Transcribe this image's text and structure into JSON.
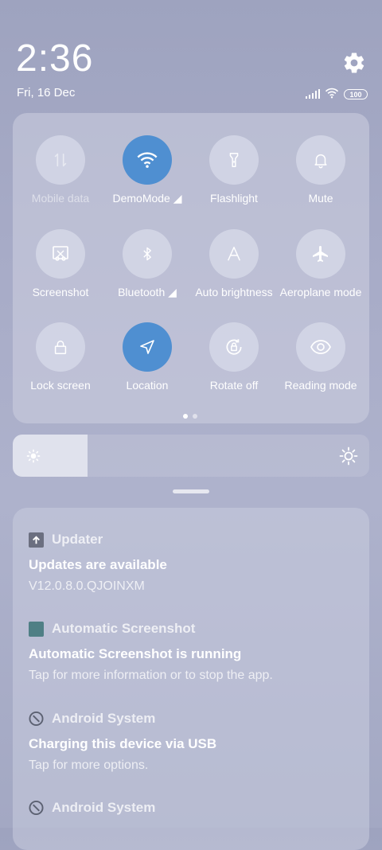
{
  "status": {
    "time": "2:36",
    "date": "Fri, 16 Dec",
    "battery": "100"
  },
  "quick_settings": {
    "tiles": [
      {
        "label": "Mobile data",
        "icon": "mobile-data-icon",
        "state": "disabled"
      },
      {
        "label": "DemoMode",
        "icon": "wifi-icon",
        "state": "on"
      },
      {
        "label": "Flashlight",
        "icon": "flashlight-icon",
        "state": "off"
      },
      {
        "label": "Mute",
        "icon": "bell-icon",
        "state": "off"
      },
      {
        "label": "Screenshot",
        "icon": "screenshot-icon",
        "state": "off"
      },
      {
        "label": "Bluetooth",
        "icon": "bluetooth-icon",
        "state": "off"
      },
      {
        "label": "Auto brightness",
        "icon": "auto-brightness-icon",
        "state": "off"
      },
      {
        "label": "Aeroplane mode",
        "icon": "airplane-icon",
        "state": "off"
      },
      {
        "label": "Lock screen",
        "icon": "lock-icon",
        "state": "off"
      },
      {
        "label": "Location",
        "icon": "location-icon",
        "state": "on"
      },
      {
        "label": "Rotate off",
        "icon": "rotate-lock-icon",
        "state": "off"
      },
      {
        "label": "Reading mode",
        "icon": "eye-icon",
        "state": "off"
      }
    ],
    "page_count": 2,
    "current_page": 1
  },
  "brightness": {
    "level": 0.21
  },
  "notifications": [
    {
      "app": "Updater",
      "title": "Updates are available",
      "body": "V12.0.8.0.QJOINXM",
      "icon": "updater-icon"
    },
    {
      "app": "Automatic Screenshot",
      "title": "Automatic Screenshot is running",
      "body": "Tap for more information or to stop the app.",
      "icon": "screenshot-app-icon"
    },
    {
      "app": "Android System",
      "title": "Charging this device via USB",
      "body": "Tap for more options.",
      "icon": "android-system-icon"
    },
    {
      "app": "Android System",
      "title": "",
      "body": "",
      "icon": "android-system-icon"
    }
  ],
  "colors": {
    "accent": "#4f8fd1",
    "background": "#a7abc7"
  }
}
